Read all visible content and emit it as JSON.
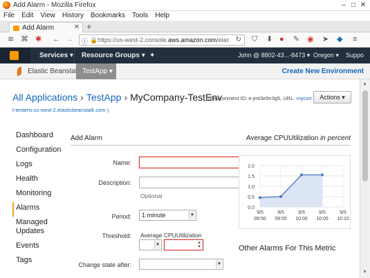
{
  "window": {
    "title": "Add Alarm - Mozilla Firefox",
    "min": "–",
    "max": "□",
    "close": "✕"
  },
  "menu": [
    "File",
    "Edit",
    "View",
    "History",
    "Bookmarks",
    "Tools",
    "Help"
  ],
  "tab": {
    "title": "Add Alarm",
    "close": "✕",
    "new": "+"
  },
  "urlbar": {
    "prefix": "https://us-west-2.console.",
    "domain": "aws.amazon.com",
    "suffix": "/elasticbeanstalk/"
  },
  "aws_nav": {
    "services": "Services",
    "resource_groups": "Resource Groups",
    "pin": "✦",
    "account": "John @ 8802-43...-8473",
    "region": "Oregon",
    "support": "Suppo"
  },
  "eb_nav": {
    "title": "Elastic Beanstalk",
    "app_tab": "TestApp",
    "create": "Create New Environment"
  },
  "breadcrumb": {
    "all_apps": "All Applications",
    "app": "TestApp",
    "env": "MyCompany-TestEnv",
    "env_id_label": "(Environment ID: e-jmt3e9n3g5, URL: ",
    "env_url_link": "mycompan",
    "env_url_cont": "t-testenv.us-west-2.elasticbeanstalk.com )",
    "actions": "Actions ▾"
  },
  "left_menu": [
    "Dashboard",
    "Configuration",
    "Logs",
    "Health",
    "Monitoring",
    "Alarms",
    "Managed Updates",
    "Events",
    "Tags"
  ],
  "form": {
    "heading": "Add Alarm",
    "chart_heading": "Average CPUUtilization",
    "chart_heading_unit": " in percent",
    "name_label": "Name:",
    "description_label": "Description:",
    "optional_hint": "Optional",
    "period_label": "Period:",
    "period_value": "1 minute",
    "threshold_label": "Threshold:",
    "threshold_metric": "Average CPUUtilization",
    "change_state_label": "Change state after:",
    "other_alarms": "Other Alarms For This Metric"
  },
  "chart_data": {
    "type": "area",
    "title": "Average CPUUtilization in percent",
    "categories": [
      "9/5 09:50",
      "9/5 09:55",
      "9/5 10:00",
      "9/5 10:05",
      "9/5 10:10"
    ],
    "y_ticks": [
      "2.0",
      "1.5",
      "1.0",
      "0.5",
      "0.0"
    ],
    "ylim": [
      0,
      2.0
    ],
    "x": [
      0,
      1,
      2,
      3
    ],
    "values": [
      0.45,
      0.5,
      1.55,
      1.55
    ],
    "colors": {
      "line": "#4a78c4",
      "fill": "#dbe5f3"
    }
  }
}
